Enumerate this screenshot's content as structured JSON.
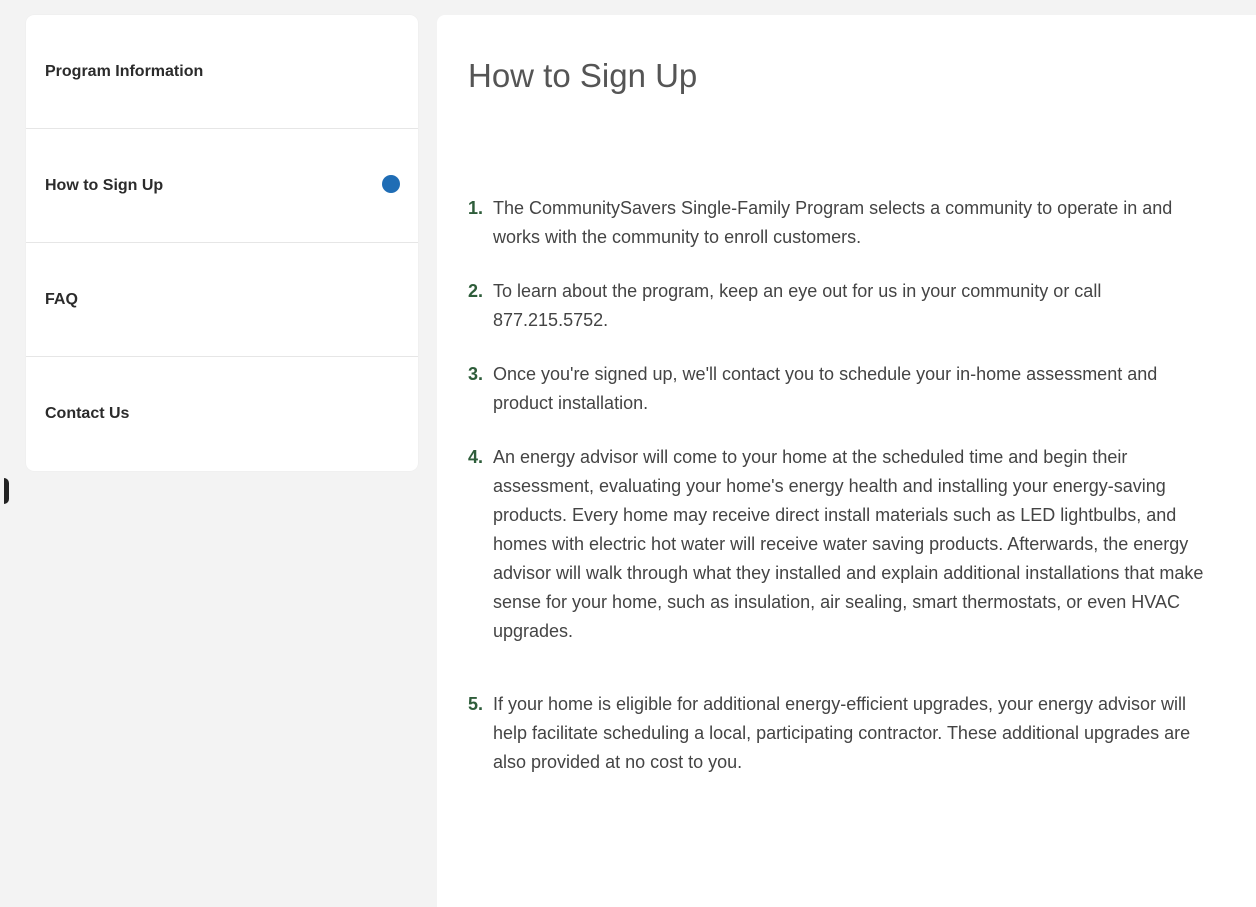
{
  "sidebar": {
    "items": [
      {
        "label": "Program Information"
      },
      {
        "label": "How to Sign Up"
      },
      {
        "label": "FAQ"
      },
      {
        "label": "Contact Us"
      }
    ]
  },
  "main": {
    "title": "How to Sign Up",
    "steps": [
      {
        "num": "1.",
        "text": "The CommunitySavers Single-Family Program selects a community to operate in and works with the community to enroll customers."
      },
      {
        "num": "2.",
        "text": "To learn about the program, keep an eye out for us in your community or call 877.215.5752."
      },
      {
        "num": "3.",
        "text": "Once you're signed up, we'll contact you to schedule your in-home assessment and product installation."
      },
      {
        "num": "4.",
        "text": "An energy advisor will come to your home at the scheduled time and begin their assessment, evaluating your home's energy health and installing your energy-saving products. Every home may receive direct install materials such as LED lightbulbs, and homes with electric hot water will receive water saving products. Afterwards, the energy advisor will walk through what they installed and explain additional installations that make sense for your home, such as insulation, air sealing, smart thermostats, or even HVAC upgrades."
      },
      {
        "num": "5.",
        "text": "If your home is eligible for additional energy-efficient upgrades, your energy advisor will help facilitate scheduling a local, participating contractor. These additional upgrades are also provided at no cost to you."
      }
    ]
  },
  "colors": {
    "active_dot": "#1f6db5",
    "step_number": "#2e5d3a",
    "page_background": "#f3f3f3"
  }
}
